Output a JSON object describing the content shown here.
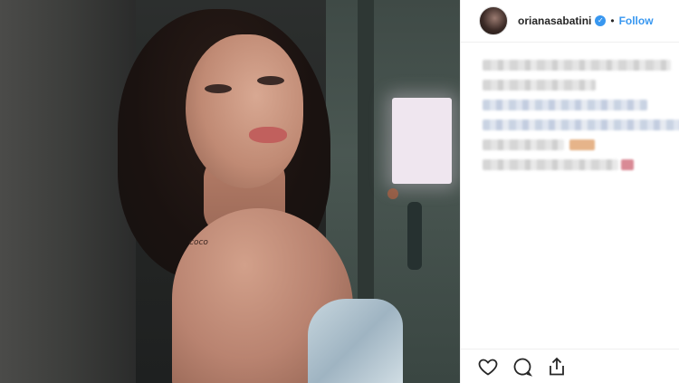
{
  "post": {
    "author": {
      "username": "orianasabatini",
      "verified": true
    },
    "header": {
      "separator": "•",
      "follow_label": "Follow"
    },
    "photo": {
      "tattoo_text": "coco"
    },
    "actions": {
      "icons": [
        "heart-icon",
        "comment-icon",
        "share-icon"
      ]
    },
    "colors": {
      "accent": "#3897f0",
      "text": "#262626",
      "border": "#efefef"
    }
  }
}
